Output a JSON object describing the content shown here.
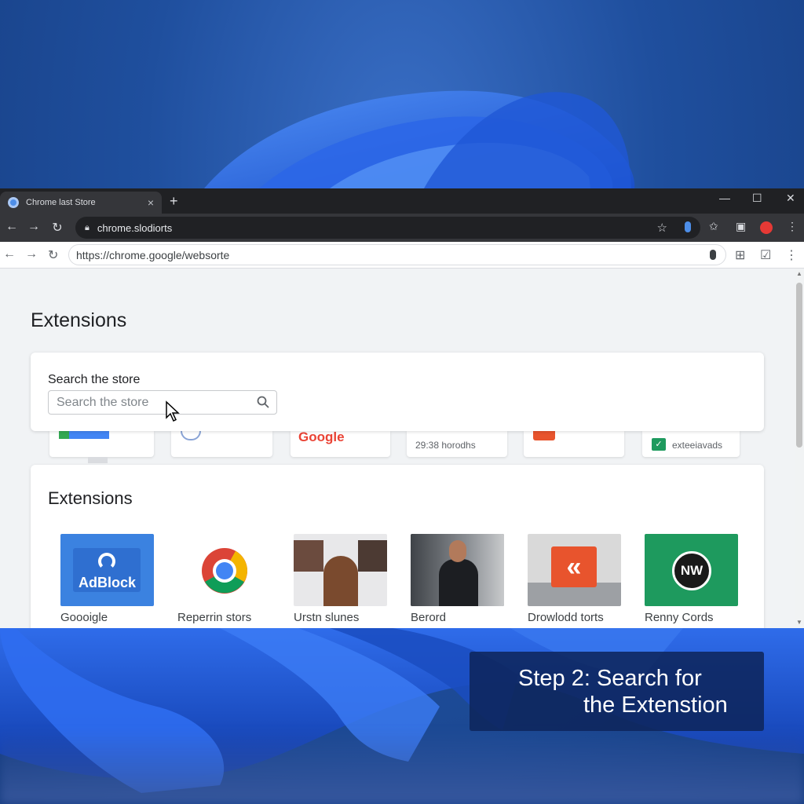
{
  "overlay": {
    "line1": "Step 2: Search for",
    "line2": "the Extenstion"
  },
  "browser": {
    "tab_title": "Chrome last Store",
    "tab_close": "×",
    "new_tab": "+",
    "window_controls": {
      "minimize": "—",
      "maximize": "☐",
      "close": "✕"
    },
    "address_bar_top": "chrome.slodiorts",
    "address_bar": "https://chrome.google/websorte",
    "accent_color": "#4d8ee8"
  },
  "page": {
    "heading": "Extensions",
    "search": {
      "label": "Search the store",
      "placeholder": "Search the store"
    },
    "peek_cards": [
      {
        "text": ""
      },
      {
        "text": ""
      },
      {
        "text": "Google"
      },
      {
        "text": "29:38 horodhs"
      },
      {
        "text": ""
      },
      {
        "text": "exteeiavads"
      }
    ],
    "extensions_section": {
      "heading": "Extensions",
      "items": [
        {
          "name": "Goooigle",
          "thumb_text": "AdBlock",
          "color": "#3b82e0"
        },
        {
          "name": "Reperrin stors",
          "thumb_text": ""
        },
        {
          "name": "Urstn slunes",
          "thumb_text": ""
        },
        {
          "name": "Berord",
          "thumb_text": ""
        },
        {
          "name": "Drowlodd torts",
          "thumb_text": ""
        },
        {
          "name": "Renny Cords",
          "thumb_text": "NW",
          "color": "#1e9a5e"
        }
      ]
    }
  }
}
